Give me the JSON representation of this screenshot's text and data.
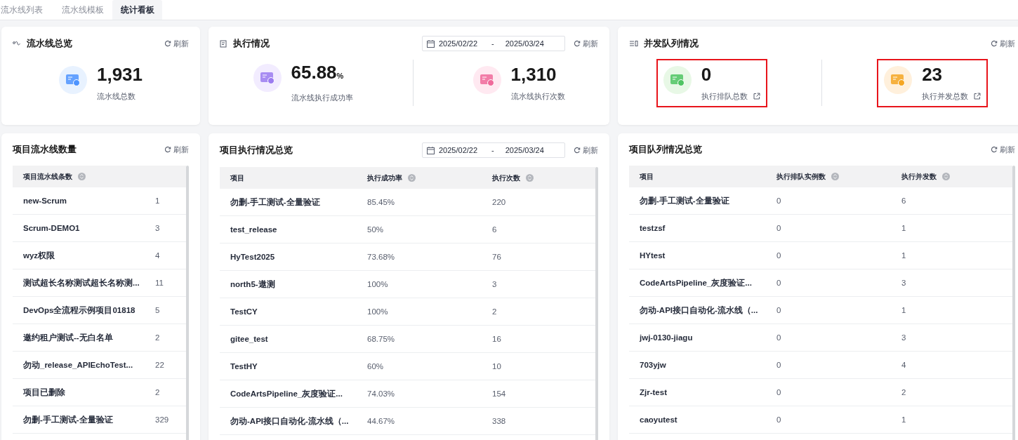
{
  "tabs": [
    {
      "label": "流水线列表",
      "selected": false
    },
    {
      "label": "流水线模板",
      "selected": false
    },
    {
      "label": "统计看板",
      "selected": true
    }
  ],
  "overview_cards": [
    {
      "kind": "pipelines",
      "title": "流水线总览",
      "refresh_label": "刷新",
      "stats": [
        {
          "kind": "pipeline",
          "value": "1,931",
          "label": "流水线总数",
          "highlighted": false,
          "external_link": false
        }
      ]
    },
    {
      "kind": "execution",
      "title": "执行情况",
      "refresh_label": "刷新",
      "date_range": {
        "start": "2025/02/22",
        "separator": "-",
        "end": "2025/03/24"
      },
      "stats": [
        {
          "kind": "rate",
          "value": "65.88",
          "unit": "%",
          "label": "流水线执行成功率",
          "highlighted": false,
          "external_link": false
        },
        {
          "kind": "count",
          "value": "1,310",
          "label": "流水线执行次数",
          "highlighted": false,
          "external_link": false
        }
      ]
    },
    {
      "kind": "queue",
      "title": "并发队列情况",
      "refresh_label": "刷新",
      "stats": [
        {
          "kind": "queue",
          "value": "0",
          "label": "执行排队总数",
          "highlighted": true,
          "external_link": true
        },
        {
          "kind": "concurrency",
          "value": "23",
          "label": "执行并发总数",
          "highlighted": true,
          "external_link": true
        }
      ]
    }
  ],
  "tables": [
    {
      "title": "项目流水线数量",
      "refresh_label": "刷新",
      "columns": [
        {
          "label": "项目流水线条数",
          "sortable": true
        }
      ],
      "rows": [
        [
          "new-Scrum",
          "1"
        ],
        [
          "Scrum-DEMO1",
          "3"
        ],
        [
          "wyz权限",
          "4"
        ],
        [
          "测试超长名称测试超长名称测...",
          "11"
        ],
        [
          "DevOps全流程示例项目01818",
          "5"
        ],
        [
          "邀约租户测试--无白名单",
          "2"
        ],
        [
          "勿动_release_APIEchoTest...",
          "22"
        ],
        [
          "项目已删除",
          "2"
        ],
        [
          "勿删-手工测试-全量验证",
          "329"
        ]
      ]
    },
    {
      "title": "项目执行情况总览",
      "refresh_label": "刷新",
      "date_range": {
        "start": "2025/02/22",
        "separator": "-",
        "end": "2025/03/24"
      },
      "columns": [
        {
          "label": "项目",
          "sortable": false
        },
        {
          "label": "执行成功率",
          "sortable": true
        },
        {
          "label": "执行次数",
          "sortable": true
        }
      ],
      "rows": [
        [
          "勿删-手工测试-全量验证",
          "85.45%",
          "220"
        ],
        [
          "test_release",
          "50%",
          "6"
        ],
        [
          "HyTest2025",
          "73.68%",
          "76"
        ],
        [
          "north5-遨测",
          "100%",
          "3"
        ],
        [
          "TestCY",
          "100%",
          "2"
        ],
        [
          "gitee_test",
          "68.75%",
          "16"
        ],
        [
          "TestHY",
          "60%",
          "10"
        ],
        [
          "CodeArtsPipeline_灰度验证...",
          "74.03%",
          "154"
        ],
        [
          "勿动-API接口自动化-流水线（...",
          "44.67%",
          "338"
        ]
      ]
    },
    {
      "title": "项目队列情况总览",
      "refresh_label": "刷新",
      "columns": [
        {
          "label": "项目",
          "sortable": false
        },
        {
          "label": "执行排队实例数",
          "sortable": true
        },
        {
          "label": "执行并发数",
          "sortable": true
        }
      ],
      "rows": [
        [
          "勿删-手工测试-全量验证",
          "0",
          "6"
        ],
        [
          "testzsf",
          "0",
          "1"
        ],
        [
          "HYtest",
          "0",
          "1"
        ],
        [
          "CodeArtsPipeline_灰度验证...",
          "0",
          "3"
        ],
        [
          "勿动-API接口自动化-流水线（...",
          "0",
          "1"
        ],
        [
          "jwj-0130-jiagu",
          "0",
          "3"
        ],
        [
          "703yjw",
          "0",
          "4"
        ],
        [
          "Zjr-test",
          "0",
          "2"
        ],
        [
          "caoyutest",
          "0",
          "1"
        ]
      ]
    }
  ]
}
